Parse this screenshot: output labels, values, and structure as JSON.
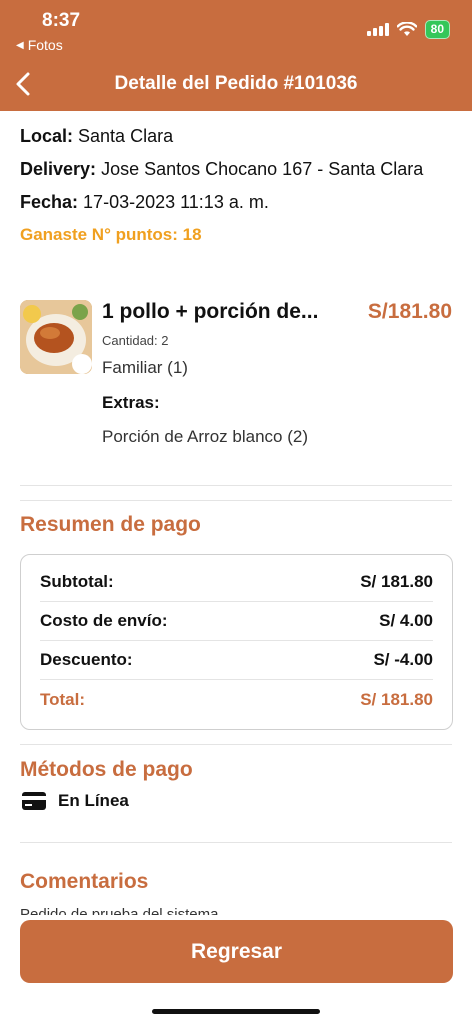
{
  "status_bar": {
    "time": "8:37",
    "back_app": "Fotos",
    "battery": "80"
  },
  "header": {
    "title": "Detalle del Pedido #101036"
  },
  "order": {
    "local_label": "Local:",
    "local_value": "Santa Clara",
    "delivery_label": "Delivery:",
    "delivery_value": "Jose Santos Chocano 167 - Santa Clara",
    "date_label": "Fecha:",
    "date_value": "17-03-2023 11:13 a. m.",
    "points": "Ganaste N° puntos: 18"
  },
  "product": {
    "name": "1 pollo + porción de...",
    "price": "S/181.80",
    "quantity": "Cantidad: 2",
    "variant": "Familiar (1)",
    "extras_label": "Extras:",
    "extra": "Porción de Arroz blanco (2)"
  },
  "summary": {
    "title": "Resumen de pago",
    "rows": [
      {
        "label": "Subtotal:",
        "value": "S/ 181.80"
      },
      {
        "label": "Costo de envío:",
        "value": "S/ 4.00"
      },
      {
        "label": "Descuento:",
        "value": "S/ -4.00"
      },
      {
        "label": "Total:",
        "value": "S/ 181.80"
      }
    ]
  },
  "payment": {
    "title": "Métodos de pago",
    "method": "En Línea",
    "icon": "credit-card-icon"
  },
  "comments": {
    "title": "Comentarios",
    "preview": "Pedido de prueba del sistema"
  },
  "actions": {
    "back_button": "Regresar"
  },
  "colors": {
    "accent": "#c86d3f",
    "points": "#f0a020"
  }
}
